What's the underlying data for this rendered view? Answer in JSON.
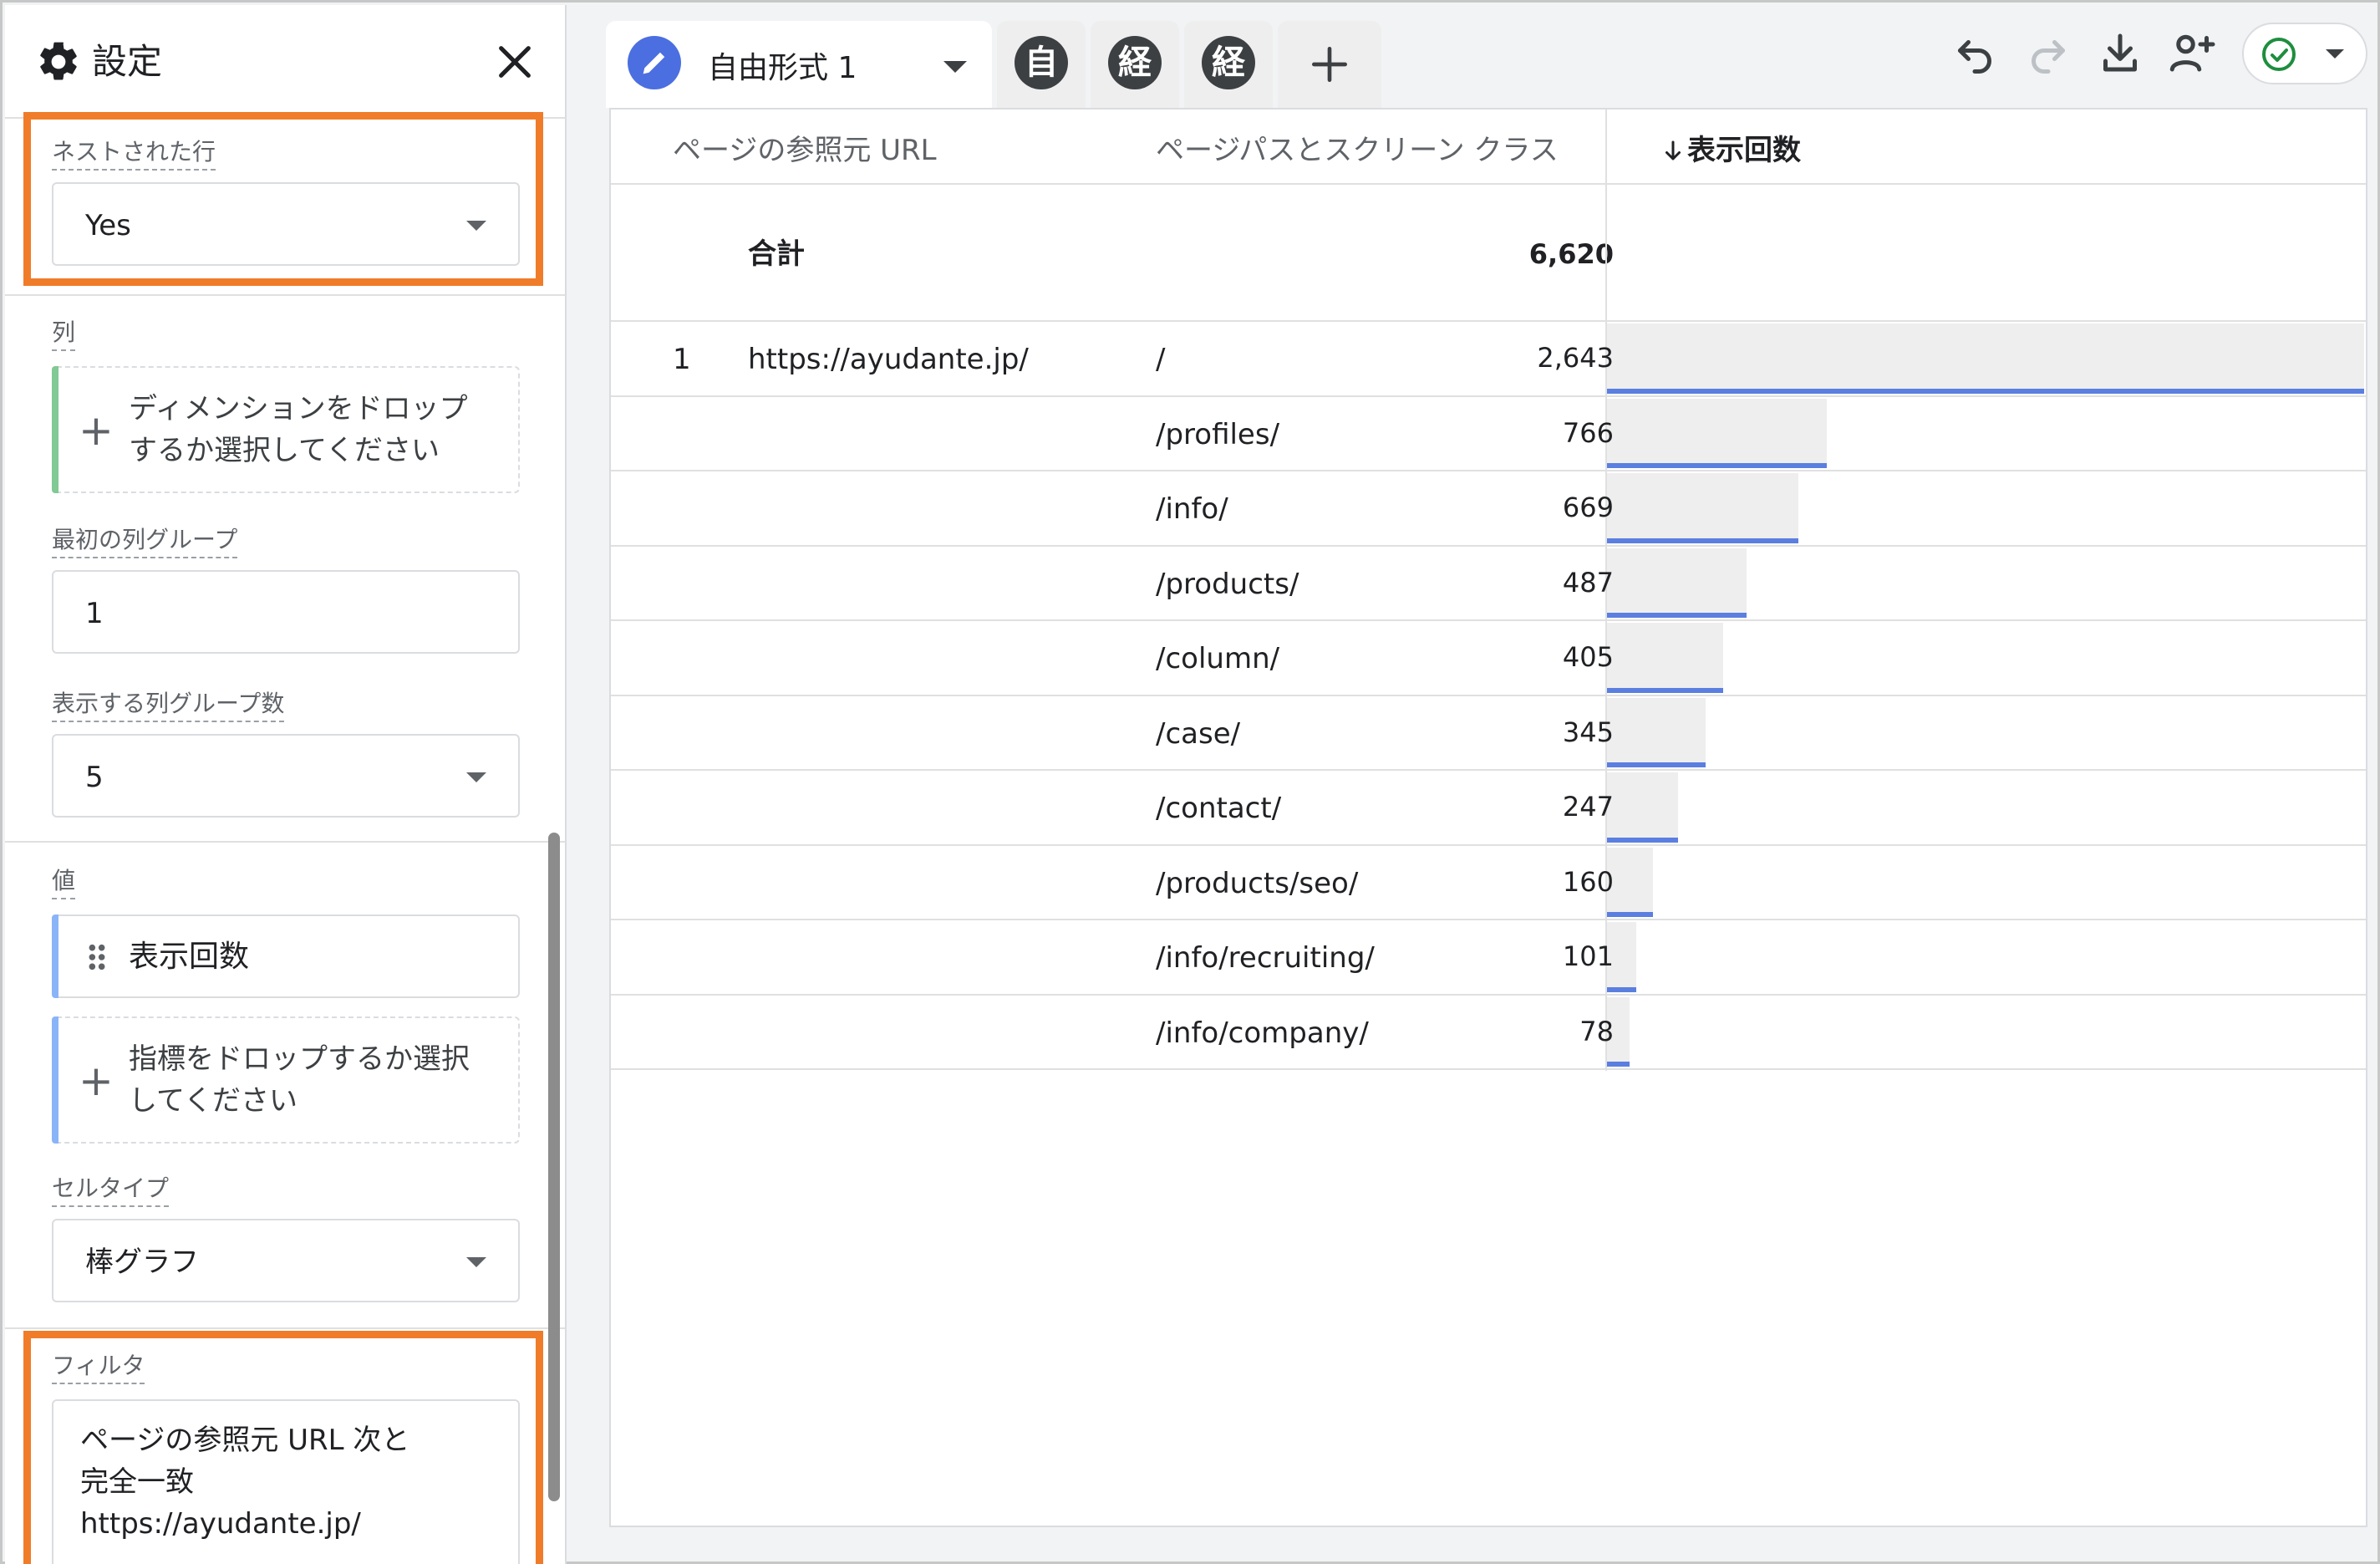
{
  "panel": {
    "title": "設定",
    "gear_icon": "gear-icon",
    "close_icon": "close-icon",
    "nested_rows": {
      "label": "ネストされた行",
      "value": "Yes"
    },
    "columns": {
      "label": "列",
      "drop_text_line1": "ディメンションをドロップ",
      "drop_text_line2": "するか選択してください"
    },
    "first_column_group": {
      "label": "最初の列グループ",
      "value": "1"
    },
    "column_groups_shown": {
      "label": "表示する列グループ数",
      "value": "5"
    },
    "values": {
      "label": "値",
      "metric": "表示回数",
      "drop_text_line1": "指標をドロップするか選択",
      "drop_text_line2": "してください"
    },
    "cell_type": {
      "label": "セルタイプ",
      "value": "棒グラフ"
    },
    "filter": {
      "label": "フィルタ",
      "line1": "ページの参照元 URL 次と",
      "line2": "完全一致",
      "line3": "https://ayudante.jp/"
    },
    "highlight_color": "#f07c2a"
  },
  "tabs": {
    "active": {
      "label": "自由形式 1",
      "icon": "pencil-icon",
      "icon_color": "#4b6fe0"
    },
    "others": [
      "自",
      "経",
      "経"
    ],
    "add_icon": "plus-icon"
  },
  "toolbar": {
    "icons": [
      "undo-icon",
      "redo-icon",
      "download-icon",
      "share-user-icon",
      "status-check-icon"
    ]
  },
  "table": {
    "headers": {
      "referrer": "ページの参照元 URL",
      "page_path": "ページパスとスクリーン クラス",
      "views": "表示回数",
      "sort_icon": "arrow-down-icon"
    },
    "total": {
      "label": "合計",
      "value": "6,620"
    },
    "rows": [
      {
        "index": "1",
        "referrer": "https://ayudante.jp/",
        "path": "/",
        "views": "2,643",
        "fraction": 1.0
      },
      {
        "index": "",
        "referrer": "",
        "path": "/profiles/",
        "views": "766",
        "fraction": 0.2898
      },
      {
        "index": "",
        "referrer": "",
        "path": "/info/",
        "views": "669",
        "fraction": 0.2531
      },
      {
        "index": "",
        "referrer": "",
        "path": "/products/",
        "views": "487",
        "fraction": 0.1843
      },
      {
        "index": "",
        "referrer": "",
        "path": "/column/",
        "views": "405",
        "fraction": 0.1532
      },
      {
        "index": "",
        "referrer": "",
        "path": "/case/",
        "views": "345",
        "fraction": 0.1305
      },
      {
        "index": "",
        "referrer": "",
        "path": "/contact/",
        "views": "247",
        "fraction": 0.0935
      },
      {
        "index": "",
        "referrer": "",
        "path": "/products/seo/",
        "views": "160",
        "fraction": 0.0605
      },
      {
        "index": "",
        "referrer": "",
        "path": "/info/recruiting/",
        "views": "101",
        "fraction": 0.0382
      },
      {
        "index": "",
        "referrer": "",
        "path": "/info/company/",
        "views": "78",
        "fraction": 0.0295
      }
    ],
    "bar_color": "#5b7fe0",
    "bar_bg_color": "#eeeeee"
  }
}
